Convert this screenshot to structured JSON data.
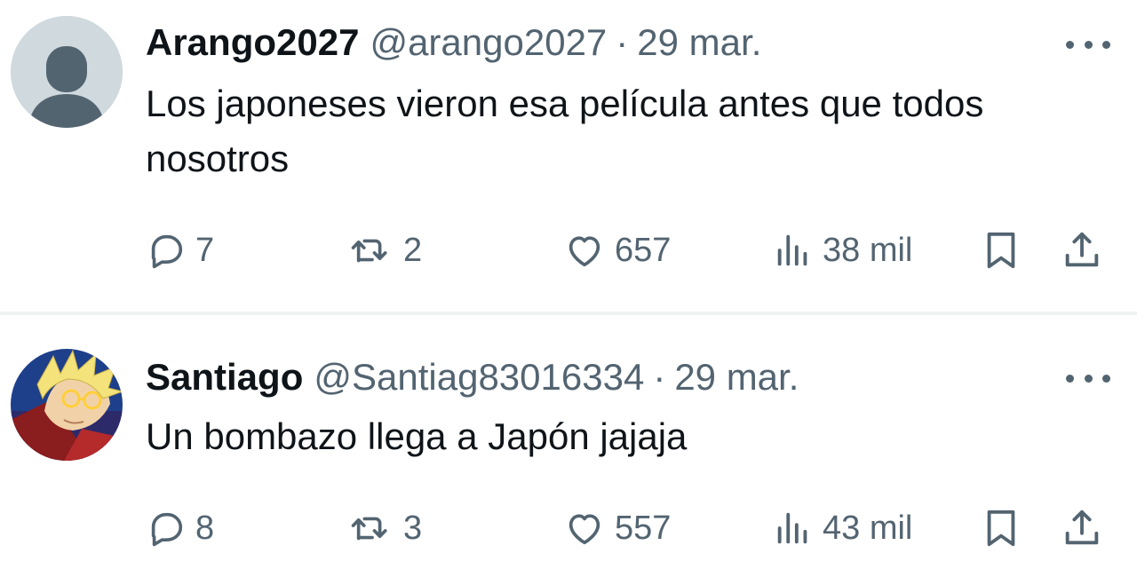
{
  "tweets": [
    {
      "name": "Arango2027",
      "handle": "@arango2027",
      "separator": "·",
      "time": "29 mar.",
      "avatar_icon": "default-user-icon",
      "text": "Los japoneses vieron esa película antes que todos nosotros",
      "replies": "7",
      "retweets": "2",
      "likes": "657",
      "views": "38 mil"
    },
    {
      "name": "Santiago",
      "handle": "@Santiag83016334",
      "separator": "·",
      "time": "29 mar.",
      "avatar_icon": "anime-character-avatar",
      "text": "Un bombazo llega a Japón jajaja",
      "replies": "8",
      "retweets": "3",
      "likes": "557",
      "views": "43 mil"
    }
  ],
  "icons": [
    "reply-icon",
    "retweet-icon",
    "like-icon",
    "views-icon",
    "bookmark-icon",
    "share-icon",
    "more-icon"
  ],
  "colors": {
    "text": "#0f1419",
    "secondary": "#536471",
    "divider": "#eff3f4",
    "avatar_placeholder": "#cfd9de"
  }
}
